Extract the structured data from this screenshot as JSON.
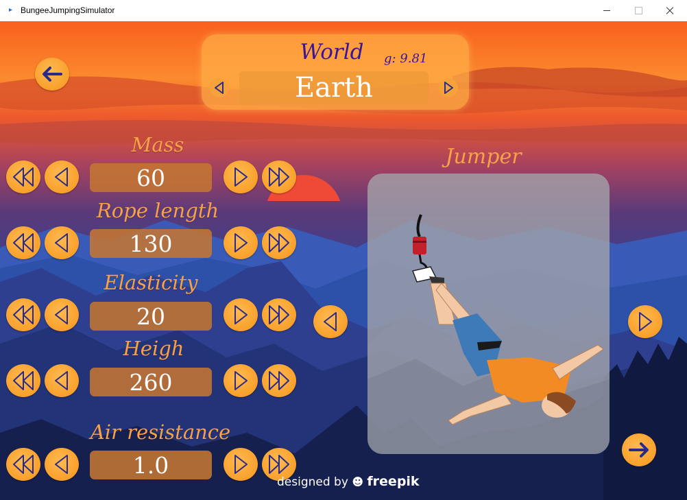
{
  "window": {
    "title": "BungeeJumpingSimulator"
  },
  "world": {
    "title": "World",
    "gravity_label": "g: 9.81",
    "name": "Earth"
  },
  "jumper": {
    "title": "Jumper"
  },
  "parameters": [
    {
      "label": "Mass",
      "value": "60"
    },
    {
      "label": "Rope length",
      "value": "130"
    },
    {
      "label": "Elasticity",
      "value": "20"
    },
    {
      "label": "Heigh",
      "value": "260"
    },
    {
      "label": "Air resistance",
      "value": "1.0"
    }
  ],
  "credit": {
    "prefix": "designed by",
    "brand": "freepik"
  },
  "colors": {
    "button": "#f9a02b",
    "arrow_ink": "#2a2a88",
    "label": "#f7a148",
    "world_text": "#3a1696"
  },
  "icons": {
    "back": "arrow-left-icon",
    "next": "arrow-right-icon",
    "fast_back": "double-triangle-left-icon",
    "back_small": "triangle-left-icon",
    "fwd_small": "triangle-right-icon",
    "fast_fwd": "double-triangle-right-icon"
  }
}
